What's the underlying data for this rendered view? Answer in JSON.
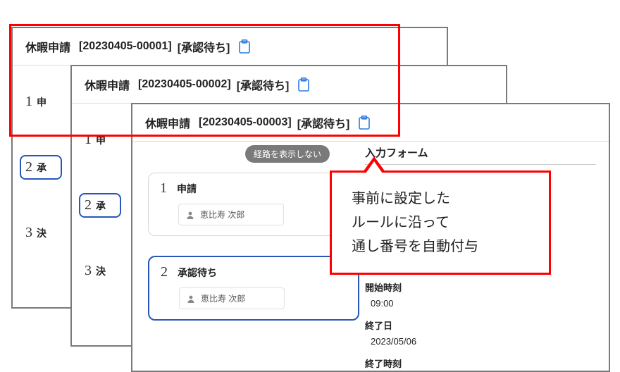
{
  "panels": [
    {
      "title": "休暇申請",
      "doc_number": "[20230405-00001]",
      "status": "[承認待ち]"
    },
    {
      "title": "休暇申請",
      "doc_number": "[20230405-00002]",
      "status": "[承認待ち]"
    },
    {
      "title": "休暇申請",
      "doc_number": "[20230405-00003]",
      "status": "[承認待ち]"
    }
  ],
  "bg_steps": {
    "a": [
      {
        "n": "1",
        "l": "申"
      },
      {
        "n": "2",
        "l": "承"
      },
      {
        "n": "3",
        "l": "決"
      }
    ],
    "b": [
      {
        "n": "1",
        "l": "申"
      },
      {
        "n": "2",
        "l": "承"
      },
      {
        "n": "3",
        "l": "決"
      }
    ]
  },
  "workflow": {
    "hide_route_label": "経路を表示しない",
    "steps": [
      {
        "num": "1",
        "name": "申請",
        "user": "恵比寿 次郎",
        "active": false
      },
      {
        "num": "2",
        "name": "承認待ち",
        "user": "恵比寿 次郎",
        "active": true
      }
    ]
  },
  "form": {
    "heading": "入力フォーム",
    "fields": {
      "start_time_label": "開始時刻",
      "start_time_value": "09:00",
      "end_date_label": "終了日",
      "end_date_value": "2023/05/06",
      "end_time_label": "終了時刻"
    }
  },
  "callout": {
    "line1": "事前に設定した",
    "line2": "ルールに沿って",
    "line3": "通し番号を自動付与"
  }
}
